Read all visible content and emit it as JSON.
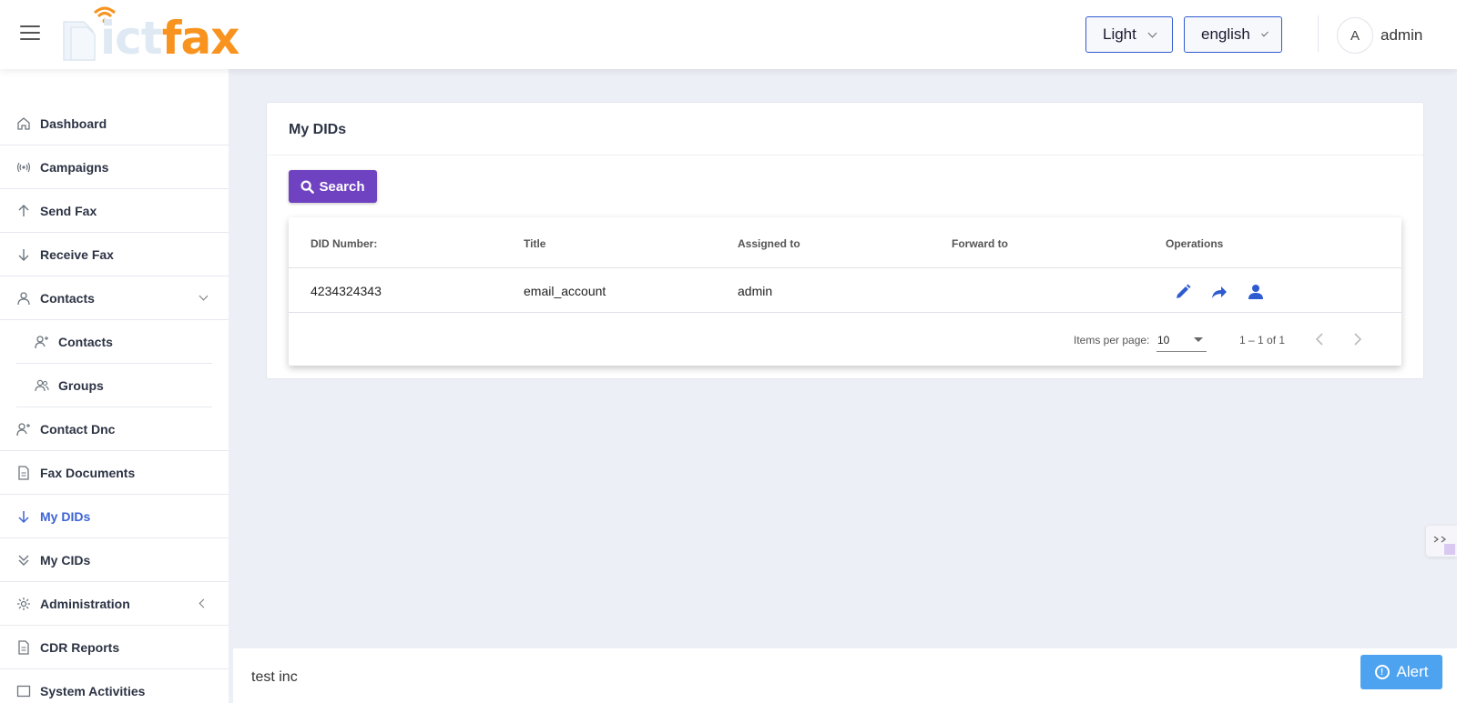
{
  "header": {
    "logo": {
      "part1": "ict",
      "part2": "fax"
    },
    "theme_select": "Light",
    "language_select": "english",
    "avatar_initial": "A",
    "username": "admin"
  },
  "sidebar": {
    "items": [
      {
        "label": "Dashboard",
        "icon": "home-icon"
      },
      {
        "label": "Campaigns",
        "icon": "broadcast-icon"
      },
      {
        "label": "Send Fax",
        "icon": "arrow-up-icon"
      },
      {
        "label": "Receive Fax",
        "icon": "arrow-down-icon"
      },
      {
        "label": "Contacts",
        "icon": "user-icon"
      },
      {
        "label": "Contacts",
        "icon": "user-plus-icon"
      },
      {
        "label": "Groups",
        "icon": "users-icon"
      },
      {
        "label": "Contact Dnc",
        "icon": "user-plus-icon"
      },
      {
        "label": "Fax Documents",
        "icon": "document-icon"
      },
      {
        "label": "My DIDs",
        "icon": "arrow-down-icon"
      },
      {
        "label": "My CIDs",
        "icon": "chevrons-down-icon"
      },
      {
        "label": "Administration",
        "icon": "gear-icon"
      },
      {
        "label": "CDR Reports",
        "icon": "document-icon"
      },
      {
        "label": "System Activities",
        "icon": "window-icon"
      }
    ]
  },
  "main": {
    "card_title": "My DIDs",
    "search_label": "Search",
    "table": {
      "headers": [
        "DID Number:",
        "Title",
        "Assigned to",
        "Forward to",
        "Operations"
      ],
      "rows": [
        {
          "did": "4234324343",
          "title": "email_account",
          "assigned": "admin",
          "forward": ""
        }
      ]
    },
    "paginator": {
      "items_per_page_label": "Items per page:",
      "page_size": "10",
      "range": "1 – 1 of 1"
    }
  },
  "footer": {
    "text": "test inc"
  },
  "alert_label": "Alert",
  "colors": {
    "accent": "#3e64d6",
    "search": "#6f42c1",
    "alert": "#4da3f0",
    "logo_orange": "#f7931e"
  }
}
